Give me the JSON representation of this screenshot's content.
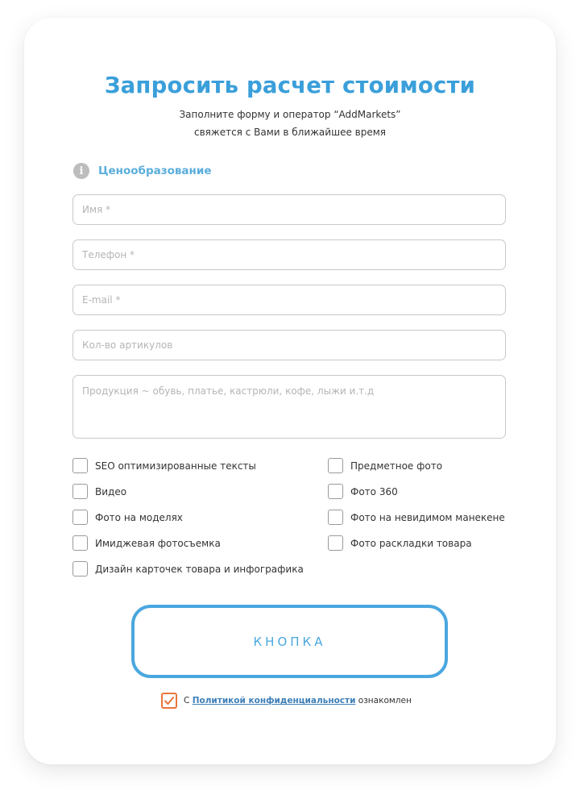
{
  "form": {
    "title": "Запросить расчет стоимости",
    "subtitle_line1": "Заполните форму и оператор “AddMarkets”",
    "subtitle_line2": "свяжется с Вами в ближайшее время",
    "section": {
      "icon": "info-icon",
      "icon_glyph": "i",
      "label": "Ценообразование"
    },
    "fields": {
      "name_placeholder": "Имя *",
      "phone_placeholder": "Телефон *",
      "email_placeholder": "E-mail *",
      "articles_placeholder": "Кол-во артикулов",
      "products_placeholder": "Продукция ~ обувь, платье, кастрюли, кофе, лыжи и.т.д"
    },
    "services": {
      "seo": "SEO оптимизированные тексты",
      "video": "Видео",
      "models": "Фото на моделях",
      "image": "Имиджевая фотосъемка",
      "design": "Дизайн карточек товара и инфографика",
      "subject": "Предметное фото",
      "photo360": "Фото 360",
      "mannequin": "Фото на невидимом манекене",
      "layout": "Фото раскладки товара"
    },
    "submit_label": "КНОПКА",
    "agreement": {
      "checked": true,
      "prefix": "С",
      "link_text": "Политикой конфиденциальности",
      "suffix": "ознакомлен"
    }
  },
  "colors": {
    "accent": "#3a9fda",
    "button_border": "#4aa7df",
    "checkbox_checked": "#e8763a",
    "link": "#3e7fb7"
  }
}
